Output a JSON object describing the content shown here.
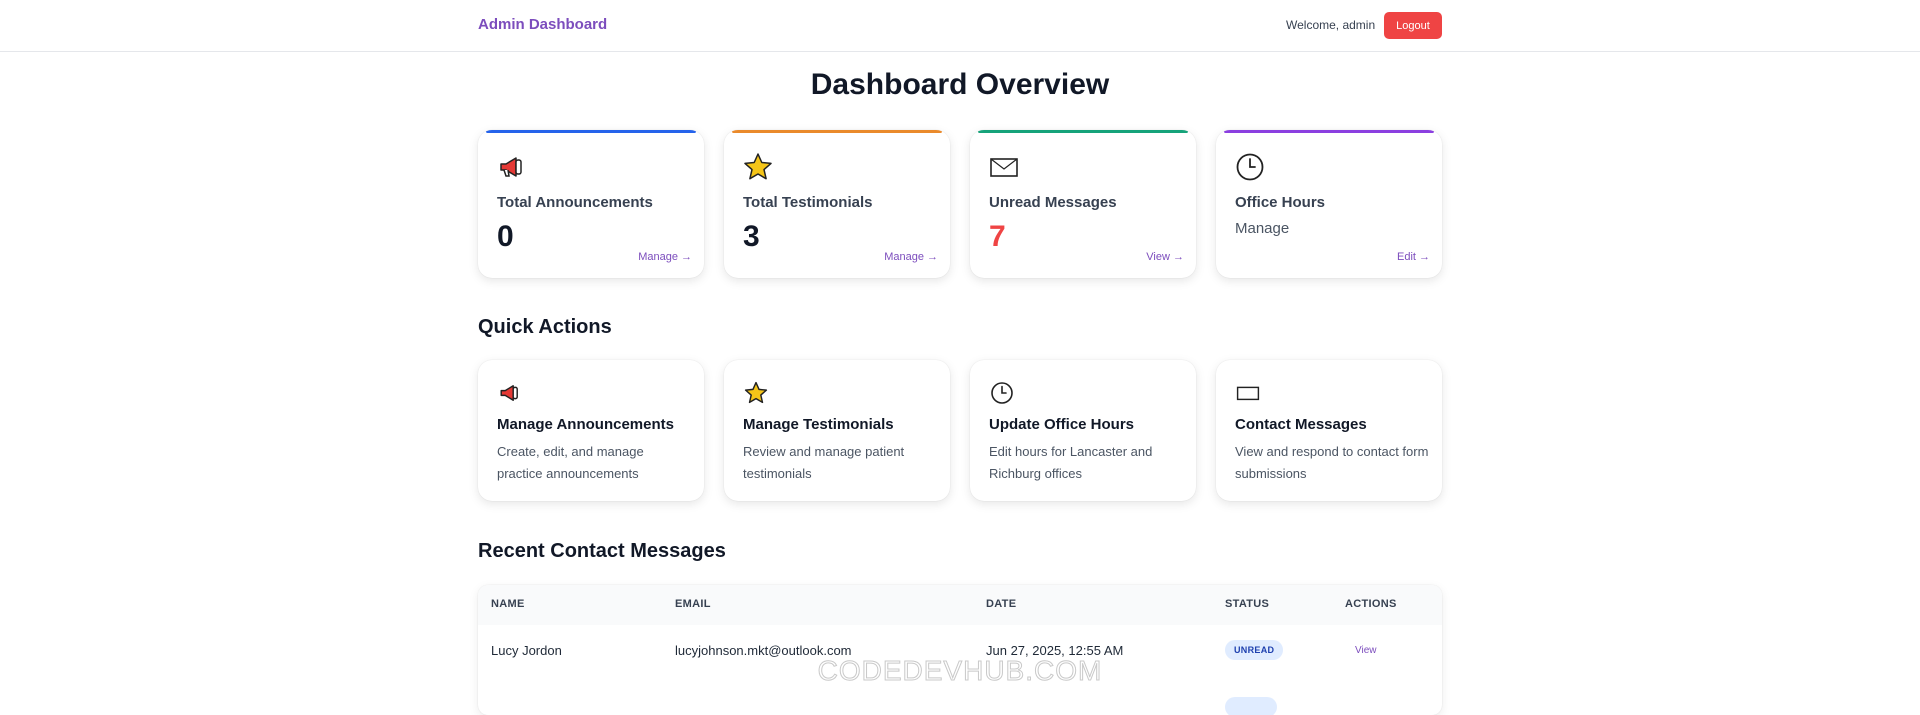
{
  "header": {
    "brand": "Admin Dashboard",
    "welcome": "Welcome, admin",
    "logout_label": "Logout"
  },
  "page_title": "Dashboard Overview",
  "stats": [
    {
      "icon": "megaphone-icon",
      "label": "Total Announcements",
      "value": "0",
      "link": "Manage →",
      "accent": "#2563eb"
    },
    {
      "icon": "star-icon",
      "label": "Total Testimonials",
      "value": "3",
      "link": "Manage →",
      "accent": "#ea8a2b"
    },
    {
      "icon": "envelope-icon",
      "label": "Unread Messages",
      "value": "7",
      "link": "View →",
      "accent": "#16a37a"
    },
    {
      "icon": "clock-icon",
      "label": "Office Hours",
      "value": "Manage",
      "link": "Edit →",
      "accent": "#8b3fe0"
    }
  ],
  "quick_actions": {
    "title": "Quick Actions",
    "items": [
      {
        "icon": "megaphone-icon",
        "title": "Manage Announcements",
        "desc": "Create, edit, and manage practice announcements"
      },
      {
        "icon": "star-icon",
        "title": "Manage Testimonials",
        "desc": "Review and manage patient testimonials"
      },
      {
        "icon": "clock-icon",
        "title": "Update Office Hours",
        "desc": "Edit hours for Lancaster and Richburg offices"
      },
      {
        "icon": "envelope-icon",
        "title": "Contact Messages",
        "desc": "View and respond to contact form submissions"
      }
    ]
  },
  "messages": {
    "title": "Recent Contact Messages",
    "columns": [
      "NAME",
      "EMAIL",
      "DATE",
      "STATUS",
      "ACTIONS"
    ],
    "rows": [
      {
        "name": "Lucy Jordon",
        "email": "lucyjohnson.mkt@outlook.com",
        "date": "Jun 27, 2025, 12:55 AM",
        "status": "UNREAD",
        "action": "View"
      }
    ]
  },
  "watermark": "CODEDEVHUB.COM",
  "colors": {
    "brand": "#7c4dbd",
    "danger": "#ef4444",
    "badge_bg": "#e0ecff"
  }
}
